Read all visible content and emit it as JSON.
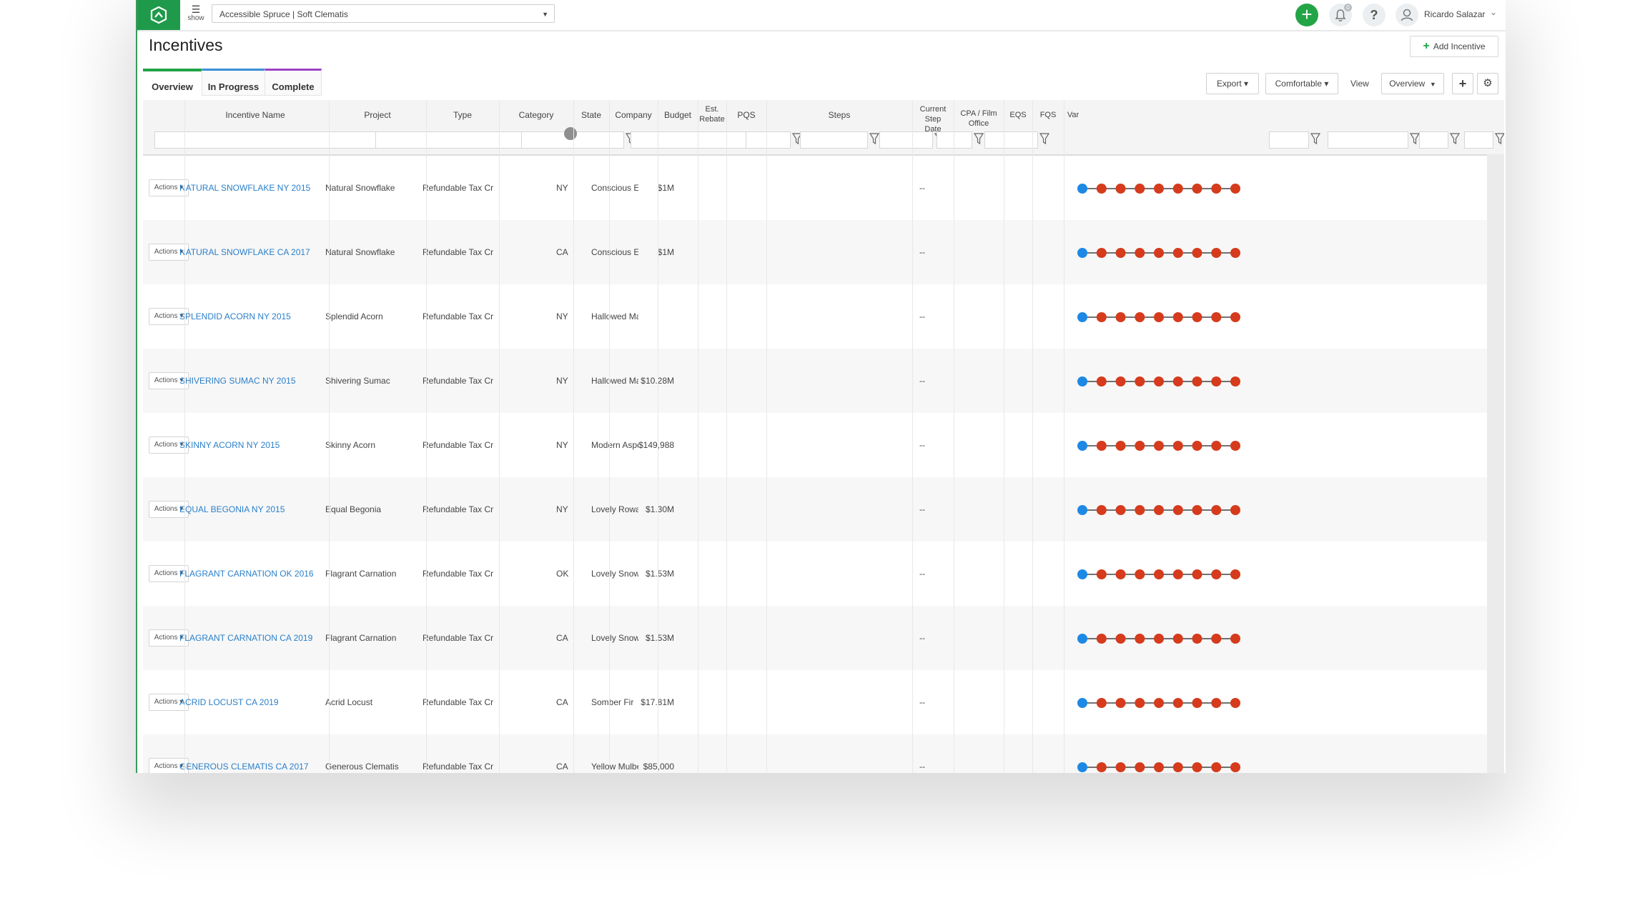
{
  "topbar": {
    "menu_label": "show",
    "project_select": "Accessible Spruce | Soft Clematis",
    "notification_count": "0",
    "help_label": "?",
    "user_name": "Ricardo Salazar"
  },
  "page": {
    "title": "Incentives",
    "add_button": "Add Incentive"
  },
  "tabs": [
    "Overview",
    "In Progress",
    "Complete"
  ],
  "toolbar": {
    "export": "Export",
    "density": "Comfortable",
    "view_label": "View",
    "view_value": "Overview"
  },
  "columns": {
    "name": "Incentive Name",
    "project": "Project",
    "type": "Type",
    "category": "Category",
    "state": "State",
    "company": "Company",
    "budget": "Budget",
    "rebate_1": "Est.",
    "rebate_2": "Rebate",
    "pqs": "PQS",
    "steps": "Steps",
    "step_date_1": "Current Step",
    "step_date_2": "Date",
    "cpa": "CPA / Film Office",
    "eqs": "EQS",
    "fqs": "FQS",
    "var": "Var"
  },
  "actions_label": "Actions",
  "rows": [
    {
      "name": "NATURAL SNOWFLAKE NY 2015",
      "project": "Natural Snowflake",
      "type": "Refundable Tax Credit",
      "state": "NY",
      "company": "Conscious East",
      "budget": "$1M",
      "cpa": "--"
    },
    {
      "name": "NATURAL SNOWFLAKE CA 2017",
      "project": "Natural Snowflake",
      "type": "Refundable Tax Credit",
      "state": "CA",
      "company": "Conscious East",
      "budget": "$1M",
      "cpa": "--"
    },
    {
      "name": "SPLENDID ACORN NY 2015",
      "project": "Splendid Acorn",
      "type": "Refundable Tax Credit",
      "state": "NY",
      "company": "Hallowed May...",
      "budget": "",
      "cpa": "--"
    },
    {
      "name": "SHIVERING SUMAC NY 2015",
      "project": "Shivering Sumac",
      "type": "Refundable Tax Credit",
      "state": "NY",
      "company": "Hallowed May...",
      "budget": "$10.28M",
      "cpa": "--"
    },
    {
      "name": "SKINNY ACORN NY 2015",
      "project": "Skinny Acorn",
      "type": "Refundable Tax Credit",
      "state": "NY",
      "company": "Modern Aspen",
      "budget": "$149,988",
      "cpa": "--"
    },
    {
      "name": "EQUAL BEGONIA NY 2015",
      "project": "Equal Begonia",
      "type": "Refundable Tax Credit",
      "state": "NY",
      "company": "Lovely Rowan",
      "budget": "$1.30M",
      "cpa": "--"
    },
    {
      "name": "FLAGRANT CARNATION OK 2016",
      "project": "Flagrant Carnation",
      "type": "Refundable Tax Credit",
      "state": "OK",
      "company": "Lovely Snowfl...",
      "budget": "$1.53M",
      "cpa": "--"
    },
    {
      "name": "FLAGRANT CARNATION CA 2019",
      "project": "Flagrant Carnation",
      "type": "Refundable Tax Credit",
      "state": "CA",
      "company": "Lovely Snowfl...",
      "budget": "$1.53M",
      "cpa": "--"
    },
    {
      "name": "ACRID LOCUST CA 2019",
      "project": "Acrid Locust",
      "type": "Refundable Tax Credit",
      "state": "CA",
      "company": "Somber Fir",
      "budget": "$17.81M",
      "cpa": "--"
    },
    {
      "name": "GENEROUS CLEMATIS CA 2017",
      "project": "Generous Clematis",
      "type": "Refundable Tax Credit",
      "state": "CA",
      "company": "Yellow Mulberry",
      "budget": "$85,000",
      "cpa": "--"
    }
  ],
  "steps": {
    "count": 9,
    "completed": 1,
    "colors": {
      "done": "#1e88e5",
      "pending": "#d53b1c"
    }
  },
  "colors": {
    "brand": "#1f9a4a",
    "link": "#2a7fc9",
    "tab_progress": "#3b8fd6",
    "tab_complete": "#9c42c4"
  }
}
